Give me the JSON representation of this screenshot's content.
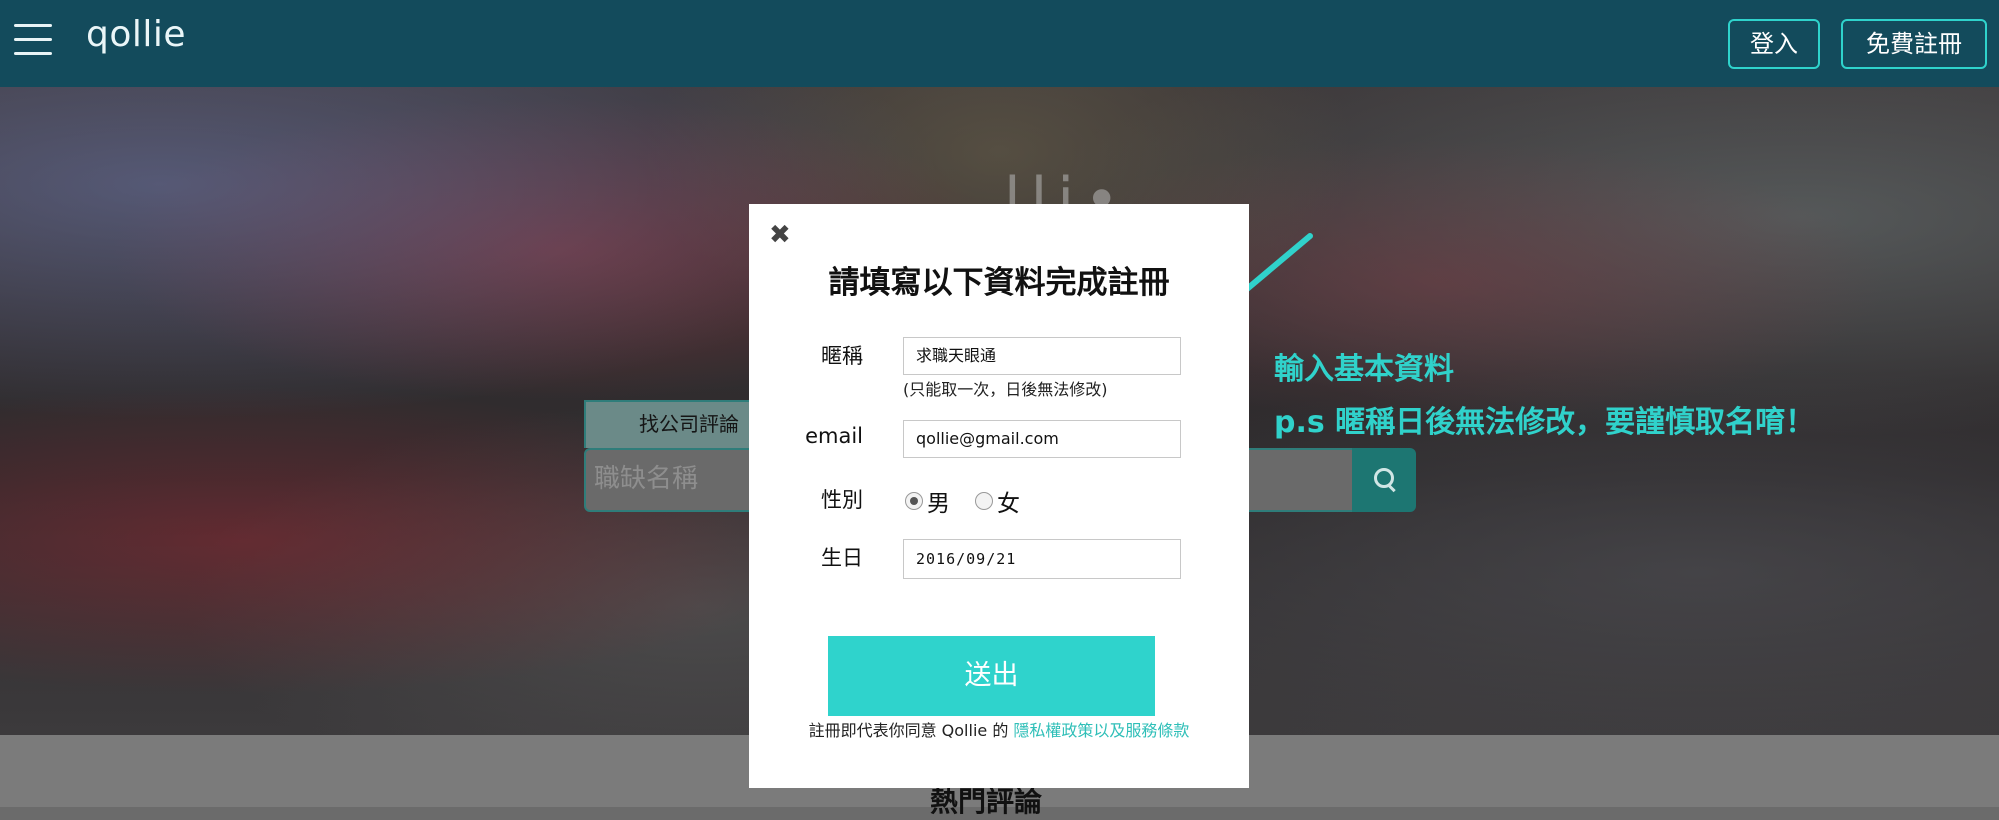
{
  "header": {
    "logo": "qollie",
    "login_label": "登入",
    "register_label": "免費註冊"
  },
  "hero": {
    "brand_text": "lli•",
    "search_tab": "找公司評論",
    "search_placeholder": "職缺名稱",
    "hot_heading": "熱門評論"
  },
  "modal": {
    "title": "請填寫以下資料完成註冊",
    "nickname_label": "暱稱",
    "nickname_value": "求職天眼通",
    "nickname_hint": "(只能取一次，日後無法修改)",
    "email_label": "email",
    "email_value": "qollie@gmail.com",
    "gender_label": "性別",
    "gender_options": [
      "男",
      "女"
    ],
    "gender_selected": "男",
    "birthday_label": "生日",
    "birthday_value": "2016/09/21",
    "submit_label": "送出",
    "terms_prefix": "註冊即代表你同意 Qollie 的 ",
    "terms_link": "隱私權政策以及服務條款"
  },
  "annotation": {
    "line1": "輸入基本資料",
    "line2": "p.s 暱稱日後無法修改，要謹慎取名唷！",
    "color": "#30d2cb"
  },
  "colors": {
    "topbar": "#134b5c",
    "accent": "#2fd3cc"
  }
}
